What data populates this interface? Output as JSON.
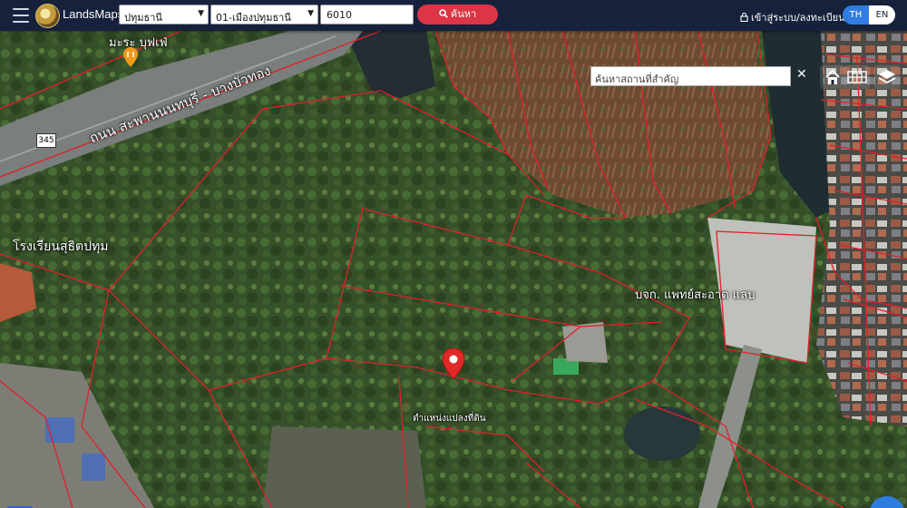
{
  "app": {
    "brand": "LandsMaps"
  },
  "search": {
    "province": "ปทุมธานี",
    "district": "01-เมืองปทุมธานี",
    "parcel_number": "6010",
    "button_label": "ค้นหา"
  },
  "header": {
    "login_label": "เข้าสู่ระบบ/ลงทะเบียน",
    "lang_th": "TH",
    "lang_en": "EN"
  },
  "map": {
    "place_search_placeholder": "ค้นหาสถานที่สำคัญ",
    "labels": {
      "road": "ถนน สะพานนนทบุรี - บางบัวทอง",
      "shop": "มะระ บุฟเฟ่",
      "school": "โรงเรียนสุธิตปทุม",
      "company": "บจก. แพทย์สะอาด แลบ",
      "road_number": "345",
      "pin": "ตำแหน่งแปลงที่ดิน"
    }
  },
  "icons": [
    "hamburger-menu-icon",
    "user-icon",
    "search-icon",
    "home-icon",
    "grid-icon",
    "layers-icon",
    "close-icon",
    "tools-icon",
    "chat-icon",
    "location-pin-icon",
    "restaurant-icon"
  ],
  "colors": {
    "topbar": "#16213c",
    "search_button": "#dc3545",
    "accent": "#2f7de1",
    "parcel_lines": "#e0202a"
  }
}
